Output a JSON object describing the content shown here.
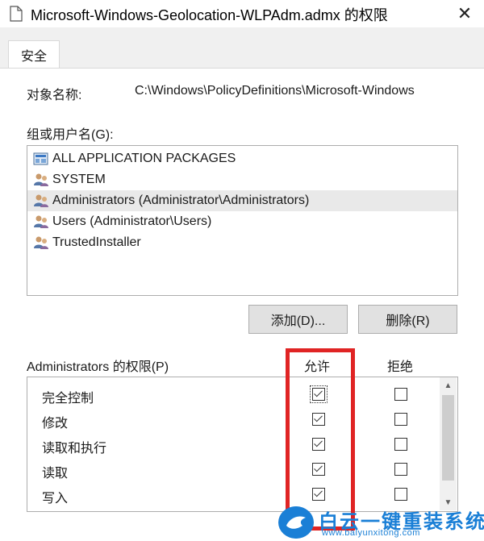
{
  "window": {
    "title": "Microsoft-Windows-Geolocation-WLPAdm.admx 的权限",
    "close_glyph": "✕",
    "icon": "document-icon"
  },
  "tabs": [
    {
      "label": "安全",
      "active": true
    }
  ],
  "object": {
    "label": "对象名称:",
    "value": "C:\\Windows\\PolicyDefinitions\\Microsoft-Windows"
  },
  "groups": {
    "label": "组或用户名(G):",
    "items": [
      {
        "label": "ALL APPLICATION PACKAGES",
        "icon": "app-packages-icon",
        "selected": false
      },
      {
        "label": "SYSTEM",
        "icon": "user-group-icon",
        "selected": false
      },
      {
        "label": "Administrators (Administrator\\Administrators)",
        "icon": "user-group-icon",
        "selected": true
      },
      {
        "label": "Users (Administrator\\Users)",
        "icon": "user-group-icon",
        "selected": false
      },
      {
        "label": "TrustedInstaller",
        "icon": "user-group-icon",
        "selected": false
      }
    ]
  },
  "buttons": {
    "add": "添加(D)...",
    "remove": "删除(R)"
  },
  "permissions": {
    "label": "Administrators 的权限(P)",
    "allow_header": "允许",
    "deny_header": "拒绝",
    "rows": [
      {
        "name": "完全控制",
        "allow": true,
        "deny": false
      },
      {
        "name": "修改",
        "allow": true,
        "deny": false
      },
      {
        "name": "读取和执行",
        "allow": true,
        "deny": false
      },
      {
        "name": "读取",
        "allow": true,
        "deny": false
      },
      {
        "name": "写入",
        "allow": true,
        "deny": false
      }
    ]
  },
  "colors": {
    "highlight": "#e02424",
    "selection": "#e9e9e9",
    "watermark": "#1a7fd6"
  },
  "watermark": {
    "text": "白云一键重装系统",
    "url": "www.baiyunxitong.com"
  }
}
